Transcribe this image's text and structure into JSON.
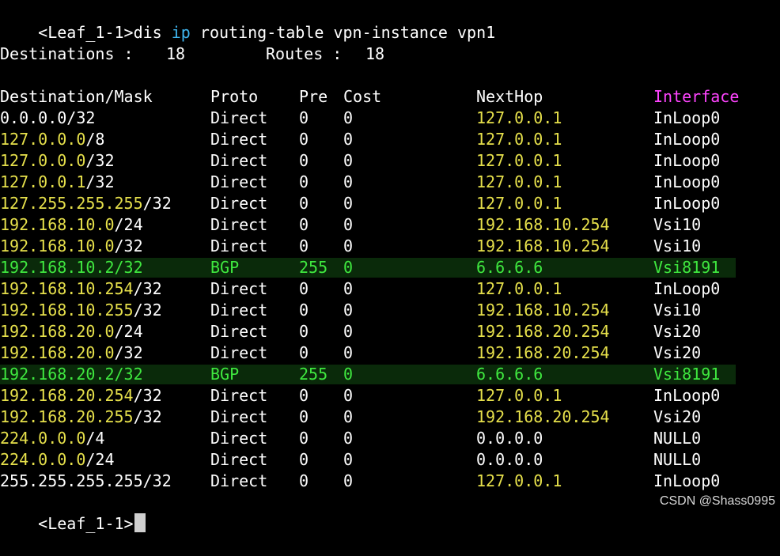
{
  "colors": {
    "white": "#ffffff",
    "yellow": "#e6e04b",
    "cyan": "#3fb6f0",
    "magenta": "#ff44ff",
    "green": "#3fe83f",
    "highlight_bg": "#0a2a0a"
  },
  "command": {
    "prompt": "<Leaf_1-1>",
    "segments": [
      {
        "text": "dis ",
        "color": "white"
      },
      {
        "text": "ip",
        "color": "cyan"
      },
      {
        "text": " routing-table vpn-instance vpn1",
        "color": "white"
      }
    ]
  },
  "summary": {
    "destinations_label": "Destinations : ",
    "destinations_value": "18",
    "routes_label": "Routes : ",
    "routes_value": "18"
  },
  "table": {
    "headers": {
      "destination": "Destination/Mask",
      "proto": "Proto",
      "pre": "Pre",
      "cost": "Cost",
      "nexthop": "NextHop",
      "interface": "Interface"
    },
    "rows": [
      {
        "dest": "0.0.0.0",
        "mask": "/32",
        "dest_color": "white",
        "proto": "Direct",
        "pre": "0",
        "cost": "0",
        "nexthop": "127.0.0.1",
        "nexthop_color": "yellow",
        "interface": "InLoop0",
        "highlight": false
      },
      {
        "dest": "127.0.0.0",
        "mask": "/8",
        "dest_color": "yellow",
        "proto": "Direct",
        "pre": "0",
        "cost": "0",
        "nexthop": "127.0.0.1",
        "nexthop_color": "yellow",
        "interface": "InLoop0",
        "highlight": false
      },
      {
        "dest": "127.0.0.0",
        "mask": "/32",
        "dest_color": "yellow",
        "proto": "Direct",
        "pre": "0",
        "cost": "0",
        "nexthop": "127.0.0.1",
        "nexthop_color": "yellow",
        "interface": "InLoop0",
        "highlight": false
      },
      {
        "dest": "127.0.0.1",
        "mask": "/32",
        "dest_color": "yellow",
        "proto": "Direct",
        "pre": "0",
        "cost": "0",
        "nexthop": "127.0.0.1",
        "nexthop_color": "yellow",
        "interface": "InLoop0",
        "highlight": false
      },
      {
        "dest": "127.255.255.255",
        "mask": "/32",
        "dest_color": "yellow",
        "proto": "Direct",
        "pre": "0",
        "cost": "0",
        "nexthop": "127.0.0.1",
        "nexthop_color": "yellow",
        "interface": "InLoop0",
        "highlight": false
      },
      {
        "dest": "192.168.10.0",
        "mask": "/24",
        "dest_color": "yellow",
        "proto": "Direct",
        "pre": "0",
        "cost": "0",
        "nexthop": "192.168.10.254",
        "nexthop_color": "yellow",
        "interface": "Vsi10",
        "highlight": false
      },
      {
        "dest": "192.168.10.0",
        "mask": "/32",
        "dest_color": "yellow",
        "proto": "Direct",
        "pre": "0",
        "cost": "0",
        "nexthop": "192.168.10.254",
        "nexthop_color": "yellow",
        "interface": "Vsi10",
        "highlight": false
      },
      {
        "dest": "192.168.10.2",
        "mask": "/32",
        "dest_color": "green",
        "proto": "BGP",
        "pre": "255",
        "cost": "0",
        "nexthop": "6.6.6.6",
        "nexthop_color": "green",
        "interface": "Vsi8191",
        "highlight": true
      },
      {
        "dest": "192.168.10.254",
        "mask": "/32",
        "dest_color": "yellow",
        "proto": "Direct",
        "pre": "0",
        "cost": "0",
        "nexthop": "127.0.0.1",
        "nexthop_color": "yellow",
        "interface": "InLoop0",
        "highlight": false
      },
      {
        "dest": "192.168.10.255",
        "mask": "/32",
        "dest_color": "yellow",
        "proto": "Direct",
        "pre": "0",
        "cost": "0",
        "nexthop": "192.168.10.254",
        "nexthop_color": "yellow",
        "interface": "Vsi10",
        "highlight": false
      },
      {
        "dest": "192.168.20.0",
        "mask": "/24",
        "dest_color": "yellow",
        "proto": "Direct",
        "pre": "0",
        "cost": "0",
        "nexthop": "192.168.20.254",
        "nexthop_color": "yellow",
        "interface": "Vsi20",
        "highlight": false
      },
      {
        "dest": "192.168.20.0",
        "mask": "/32",
        "dest_color": "yellow",
        "proto": "Direct",
        "pre": "0",
        "cost": "0",
        "nexthop": "192.168.20.254",
        "nexthop_color": "yellow",
        "interface": "Vsi20",
        "highlight": false
      },
      {
        "dest": "192.168.20.2",
        "mask": "/32",
        "dest_color": "green",
        "proto": "BGP",
        "pre": "255",
        "cost": "0",
        "nexthop": "6.6.6.6",
        "nexthop_color": "green",
        "interface": "Vsi8191",
        "highlight": true
      },
      {
        "dest": "192.168.20.254",
        "mask": "/32",
        "dest_color": "yellow",
        "proto": "Direct",
        "pre": "0",
        "cost": "0",
        "nexthop": "127.0.0.1",
        "nexthop_color": "yellow",
        "interface": "InLoop0",
        "highlight": false
      },
      {
        "dest": "192.168.20.255",
        "mask": "/32",
        "dest_color": "yellow",
        "proto": "Direct",
        "pre": "0",
        "cost": "0",
        "nexthop": "192.168.20.254",
        "nexthop_color": "yellow",
        "interface": "Vsi20",
        "highlight": false
      },
      {
        "dest": "224.0.0.0",
        "mask": "/4",
        "dest_color": "yellow",
        "proto": "Direct",
        "pre": "0",
        "cost": "0",
        "nexthop": "0.0.0.0",
        "nexthop_color": "white",
        "interface": "NULL0",
        "highlight": false
      },
      {
        "dest": "224.0.0.0",
        "mask": "/24",
        "dest_color": "yellow",
        "proto": "Direct",
        "pre": "0",
        "cost": "0",
        "nexthop": "0.0.0.0",
        "nexthop_color": "white",
        "interface": "NULL0",
        "highlight": false
      },
      {
        "dest": "255.255.255.255",
        "mask": "/32",
        "dest_color": "white",
        "proto": "Direct",
        "pre": "0",
        "cost": "0",
        "nexthop": "127.0.0.1",
        "nexthop_color": "yellow",
        "interface": "InLoop0",
        "highlight": false
      }
    ]
  },
  "final_prompt": "<Leaf_1-1>",
  "watermark": "CSDN @Shass0995"
}
